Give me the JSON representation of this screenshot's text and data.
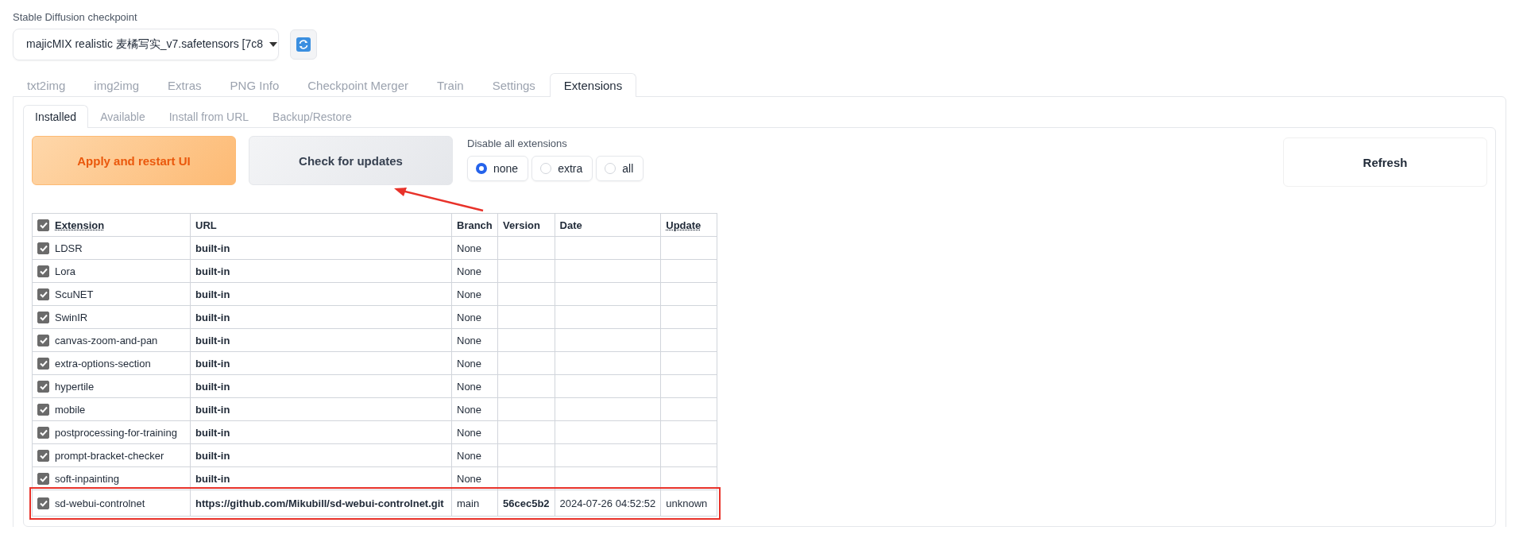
{
  "checkpoint": {
    "label": "Stable Diffusion checkpoint",
    "value": "majicMIX realistic 麦橘写实_v7.safetensors [7c8"
  },
  "tabs": [
    {
      "label": "txt2img",
      "selected": false
    },
    {
      "label": "img2img",
      "selected": false
    },
    {
      "label": "Extras",
      "selected": false
    },
    {
      "label": "PNG Info",
      "selected": false
    },
    {
      "label": "Checkpoint Merger",
      "selected": false
    },
    {
      "label": "Train",
      "selected": false
    },
    {
      "label": "Settings",
      "selected": false
    },
    {
      "label": "Extensions",
      "selected": true
    }
  ],
  "subtabs": [
    {
      "label": "Installed",
      "selected": true
    },
    {
      "label": "Available",
      "selected": false
    },
    {
      "label": "Install from URL",
      "selected": false
    },
    {
      "label": "Backup/Restore",
      "selected": false
    }
  ],
  "apply_button": "Apply and restart UI",
  "check_button": "Check for updates",
  "refresh_button": "Refresh",
  "disable": {
    "label": "Disable all extensions",
    "options": [
      {
        "label": "none",
        "selected": true
      },
      {
        "label": "extra",
        "selected": false
      },
      {
        "label": "all",
        "selected": false
      }
    ]
  },
  "annotation_arrow": true,
  "table": {
    "columns": [
      {
        "label": "Extension",
        "checked": true
      },
      {
        "label": "URL"
      },
      {
        "label": "Branch"
      },
      {
        "label": "Version"
      },
      {
        "label": "Date"
      },
      {
        "label": "Update"
      }
    ],
    "rows": [
      {
        "checked": true,
        "name": "LDSR",
        "url": "built-in",
        "branch": "None",
        "version": "",
        "date": "",
        "update": "",
        "highlighted": false
      },
      {
        "checked": true,
        "name": "Lora",
        "url": "built-in",
        "branch": "None",
        "version": "",
        "date": "",
        "update": "",
        "highlighted": false
      },
      {
        "checked": true,
        "name": "ScuNET",
        "url": "built-in",
        "branch": "None",
        "version": "",
        "date": "",
        "update": "",
        "highlighted": false
      },
      {
        "checked": true,
        "name": "SwinIR",
        "url": "built-in",
        "branch": "None",
        "version": "",
        "date": "",
        "update": "",
        "highlighted": false
      },
      {
        "checked": true,
        "name": "canvas-zoom-and-pan",
        "url": "built-in",
        "branch": "None",
        "version": "",
        "date": "",
        "update": "",
        "highlighted": false
      },
      {
        "checked": true,
        "name": "extra-options-section",
        "url": "built-in",
        "branch": "None",
        "version": "",
        "date": "",
        "update": "",
        "highlighted": false
      },
      {
        "checked": true,
        "name": "hypertile",
        "url": "built-in",
        "branch": "None",
        "version": "",
        "date": "",
        "update": "",
        "highlighted": false
      },
      {
        "checked": true,
        "name": "mobile",
        "url": "built-in",
        "branch": "None",
        "version": "",
        "date": "",
        "update": "",
        "highlighted": false
      },
      {
        "checked": true,
        "name": "postprocessing-for-training",
        "url": "built-in",
        "branch": "None",
        "version": "",
        "date": "",
        "update": "",
        "highlighted": false
      },
      {
        "checked": true,
        "name": "prompt-bracket-checker",
        "url": "built-in",
        "branch": "None",
        "version": "",
        "date": "",
        "update": "",
        "highlighted": false
      },
      {
        "checked": true,
        "name": "soft-inpainting",
        "url": "built-in",
        "branch": "None",
        "version": "",
        "date": "",
        "update": "",
        "highlighted": false
      },
      {
        "checked": true,
        "name": "sd-webui-controlnet",
        "url": "https://github.com/Mikubill/sd-webui-controlnet.git",
        "branch": "main",
        "version": "56cec5b2",
        "date": "2024-07-26 04:52:52",
        "update": "unknown",
        "highlighted": true
      }
    ]
  }
}
